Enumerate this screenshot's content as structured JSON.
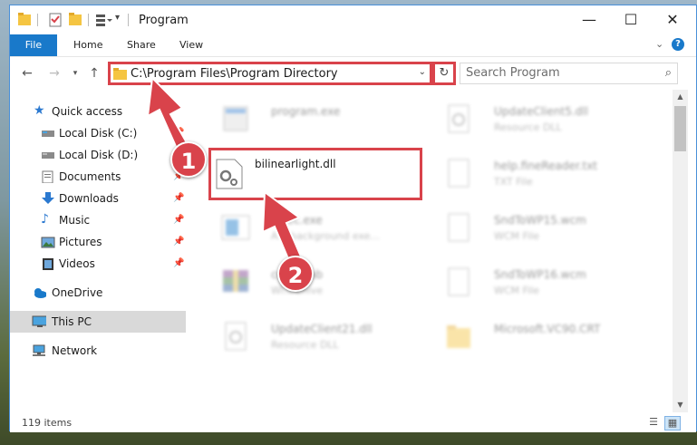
{
  "window": {
    "title": "Program",
    "controls": {
      "minimize": "—",
      "maximize": "☐",
      "close": "✕"
    }
  },
  "ribbon": {
    "tabs": [
      "File",
      "Home",
      "Share",
      "View"
    ],
    "help": "?"
  },
  "address": {
    "path": "C:\\Program Files\\Program Directory",
    "search_placeholder": "Search Program"
  },
  "nav": {
    "quick_access": "Quick access",
    "items": [
      {
        "label": "Local Disk (C:)",
        "icon": "drive-icon",
        "pinned": true
      },
      {
        "label": "Local Disk (D:)",
        "icon": "drive-icon",
        "pinned": true
      },
      {
        "label": "Documents",
        "icon": "documents-icon",
        "pinned": true
      },
      {
        "label": "Downloads",
        "icon": "downloads-icon",
        "pinned": true
      },
      {
        "label": "Music",
        "icon": "music-icon",
        "pinned": true
      },
      {
        "label": "Pictures",
        "icon": "pictures-icon",
        "pinned": true
      },
      {
        "label": "Videos",
        "icon": "videos-icon",
        "pinned": true
      }
    ],
    "onedrive": "OneDrive",
    "this_pc": "This PC",
    "network": "Network"
  },
  "files": {
    "left": [
      {
        "name": "program.exe",
        "type": ""
      },
      {
        "name": "bilinearlight.dll",
        "type": ""
      },
      {
        "name": "...sec.exe",
        "type": "A... background exe..."
      },
      {
        "name": "ce...s.cab",
        "type": "Wi... chive"
      },
      {
        "name": "UpdateClient21.dll",
        "type": "Resource DLL"
      }
    ],
    "right": [
      {
        "name": "UpdateClient5.dll",
        "type": "Resource DLL"
      },
      {
        "name": "help.fineReader.txt",
        "type": "TXT File"
      },
      {
        "name": "SndToWP15.wcm",
        "type": "WCM File"
      },
      {
        "name": "SndToWP16.wcm",
        "type": "WCM File"
      },
      {
        "name": "Microsoft.VC90.CRT",
        "type": ""
      }
    ]
  },
  "status": {
    "count": "119 items"
  },
  "markers": [
    "1",
    "2"
  ],
  "colors": {
    "accent": "#1979ca",
    "highlight": "#d9434b"
  }
}
